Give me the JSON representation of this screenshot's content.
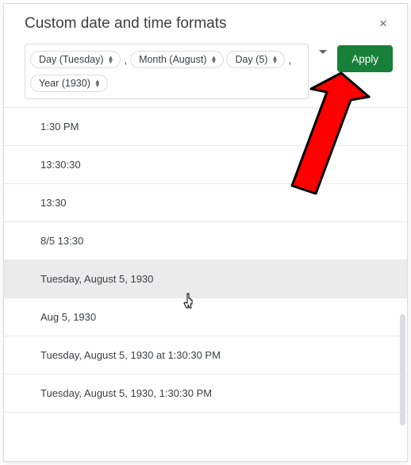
{
  "dialog": {
    "title": "Custom date and time formats",
    "close_label": "×",
    "apply_label": "Apply"
  },
  "tokens": [
    {
      "label": "Day (Tuesday)"
    },
    {
      "sep": ","
    },
    {
      "label": "Month (August)"
    },
    {
      "label": "Day (5)"
    },
    {
      "sep": ","
    },
    {
      "label": "Year (1930)"
    }
  ],
  "list": [
    "1:30 PM",
    "13:30:30",
    "13:30",
    "8/5 13:30",
    "Tuesday, August 5, 1930",
    "Aug 5, 1930",
    "Tuesday, August 5, 1930 at 1:30:30 PM",
    "Tuesday, August 5, 1930, 1:30:30 PM"
  ],
  "hover_index": 4,
  "colors": {
    "apply_bg": "#188038",
    "arrow_fill": "#ff0000",
    "arrow_stroke": "#000000"
  }
}
